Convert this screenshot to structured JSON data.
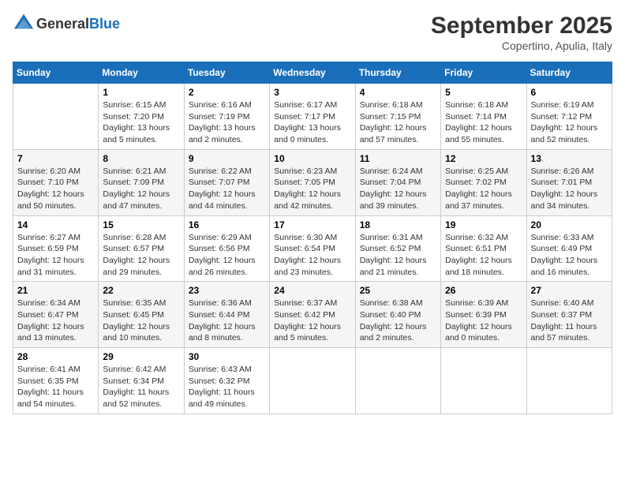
{
  "header": {
    "logo_general": "General",
    "logo_blue": "Blue",
    "month": "September 2025",
    "location": "Copertino, Apulia, Italy"
  },
  "days_of_week": [
    "Sunday",
    "Monday",
    "Tuesday",
    "Wednesday",
    "Thursday",
    "Friday",
    "Saturday"
  ],
  "weeks": [
    [
      {
        "day": "",
        "text": ""
      },
      {
        "day": "1",
        "text": "Sunrise: 6:15 AM\nSunset: 7:20 PM\nDaylight: 13 hours\nand 5 minutes."
      },
      {
        "day": "2",
        "text": "Sunrise: 6:16 AM\nSunset: 7:19 PM\nDaylight: 13 hours\nand 2 minutes."
      },
      {
        "day": "3",
        "text": "Sunrise: 6:17 AM\nSunset: 7:17 PM\nDaylight: 13 hours\nand 0 minutes."
      },
      {
        "day": "4",
        "text": "Sunrise: 6:18 AM\nSunset: 7:15 PM\nDaylight: 12 hours\nand 57 minutes."
      },
      {
        "day": "5",
        "text": "Sunrise: 6:18 AM\nSunset: 7:14 PM\nDaylight: 12 hours\nand 55 minutes."
      },
      {
        "day": "6",
        "text": "Sunrise: 6:19 AM\nSunset: 7:12 PM\nDaylight: 12 hours\nand 52 minutes."
      }
    ],
    [
      {
        "day": "7",
        "text": "Sunrise: 6:20 AM\nSunset: 7:10 PM\nDaylight: 12 hours\nand 50 minutes."
      },
      {
        "day": "8",
        "text": "Sunrise: 6:21 AM\nSunset: 7:09 PM\nDaylight: 12 hours\nand 47 minutes."
      },
      {
        "day": "9",
        "text": "Sunrise: 6:22 AM\nSunset: 7:07 PM\nDaylight: 12 hours\nand 44 minutes."
      },
      {
        "day": "10",
        "text": "Sunrise: 6:23 AM\nSunset: 7:05 PM\nDaylight: 12 hours\nand 42 minutes."
      },
      {
        "day": "11",
        "text": "Sunrise: 6:24 AM\nSunset: 7:04 PM\nDaylight: 12 hours\nand 39 minutes."
      },
      {
        "day": "12",
        "text": "Sunrise: 6:25 AM\nSunset: 7:02 PM\nDaylight: 12 hours\nand 37 minutes."
      },
      {
        "day": "13",
        "text": "Sunrise: 6:26 AM\nSunset: 7:01 PM\nDaylight: 12 hours\nand 34 minutes."
      }
    ],
    [
      {
        "day": "14",
        "text": "Sunrise: 6:27 AM\nSunset: 6:59 PM\nDaylight: 12 hours\nand 31 minutes."
      },
      {
        "day": "15",
        "text": "Sunrise: 6:28 AM\nSunset: 6:57 PM\nDaylight: 12 hours\nand 29 minutes."
      },
      {
        "day": "16",
        "text": "Sunrise: 6:29 AM\nSunset: 6:56 PM\nDaylight: 12 hours\nand 26 minutes."
      },
      {
        "day": "17",
        "text": "Sunrise: 6:30 AM\nSunset: 6:54 PM\nDaylight: 12 hours\nand 23 minutes."
      },
      {
        "day": "18",
        "text": "Sunrise: 6:31 AM\nSunset: 6:52 PM\nDaylight: 12 hours\nand 21 minutes."
      },
      {
        "day": "19",
        "text": "Sunrise: 6:32 AM\nSunset: 6:51 PM\nDaylight: 12 hours\nand 18 minutes."
      },
      {
        "day": "20",
        "text": "Sunrise: 6:33 AM\nSunset: 6:49 PM\nDaylight: 12 hours\nand 16 minutes."
      }
    ],
    [
      {
        "day": "21",
        "text": "Sunrise: 6:34 AM\nSunset: 6:47 PM\nDaylight: 12 hours\nand 13 minutes."
      },
      {
        "day": "22",
        "text": "Sunrise: 6:35 AM\nSunset: 6:45 PM\nDaylight: 12 hours\nand 10 minutes."
      },
      {
        "day": "23",
        "text": "Sunrise: 6:36 AM\nSunset: 6:44 PM\nDaylight: 12 hours\nand 8 minutes."
      },
      {
        "day": "24",
        "text": "Sunrise: 6:37 AM\nSunset: 6:42 PM\nDaylight: 12 hours\nand 5 minutes."
      },
      {
        "day": "25",
        "text": "Sunrise: 6:38 AM\nSunset: 6:40 PM\nDaylight: 12 hours\nand 2 minutes."
      },
      {
        "day": "26",
        "text": "Sunrise: 6:39 AM\nSunset: 6:39 PM\nDaylight: 12 hours\nand 0 minutes."
      },
      {
        "day": "27",
        "text": "Sunrise: 6:40 AM\nSunset: 6:37 PM\nDaylight: 11 hours\nand 57 minutes."
      }
    ],
    [
      {
        "day": "28",
        "text": "Sunrise: 6:41 AM\nSunset: 6:35 PM\nDaylight: 11 hours\nand 54 minutes."
      },
      {
        "day": "29",
        "text": "Sunrise: 6:42 AM\nSunset: 6:34 PM\nDaylight: 11 hours\nand 52 minutes."
      },
      {
        "day": "30",
        "text": "Sunrise: 6:43 AM\nSunset: 6:32 PM\nDaylight: 11 hours\nand 49 minutes."
      },
      {
        "day": "",
        "text": ""
      },
      {
        "day": "",
        "text": ""
      },
      {
        "day": "",
        "text": ""
      },
      {
        "day": "",
        "text": ""
      }
    ]
  ]
}
